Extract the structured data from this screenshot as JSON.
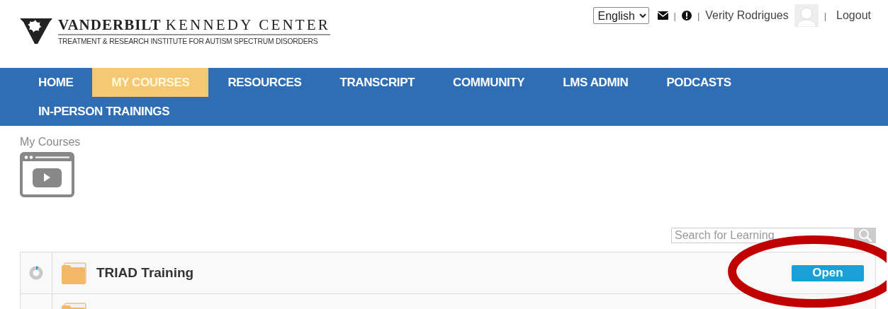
{
  "logo": {
    "name_bold": "VANDERBILT",
    "name_rest": "KENNEDY CENTER",
    "subtitle": "TREATMENT & RESEARCH INSTITUTE FOR AUTISM SPECTRUM DISORDERS"
  },
  "user_bar": {
    "language": "English",
    "separator": "|",
    "user_name": "Verity Rodrigues",
    "logout": "Logout"
  },
  "nav": [
    {
      "label": "HOME",
      "selected": false
    },
    {
      "label": "MY COURSES",
      "selected": true
    },
    {
      "label": "RESOURCES",
      "selected": false
    },
    {
      "label": "TRANSCRIPT",
      "selected": false
    },
    {
      "label": "COMMUNITY",
      "selected": false
    },
    {
      "label": "LMS ADMIN",
      "selected": false
    },
    {
      "label": "PODCASTS",
      "selected": false
    },
    {
      "label": "IN-PERSON TRAININGS",
      "selected": false
    }
  ],
  "breadcrumb": "My Courses",
  "search": {
    "placeholder": "Search for Learning"
  },
  "courses": [
    {
      "kind": "course",
      "title": "TRIAD Training",
      "button": "Open",
      "highlighted": true
    },
    {
      "kind": "cut"
    }
  ]
}
